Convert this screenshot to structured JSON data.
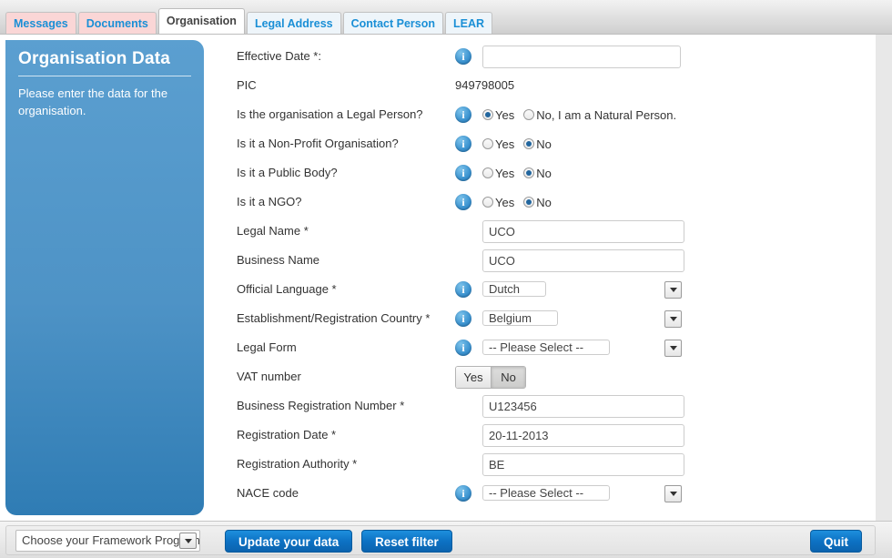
{
  "tabs": [
    {
      "label": "Messages",
      "state": "alert"
    },
    {
      "label": "Documents",
      "state": "alert"
    },
    {
      "label": "Organisation",
      "state": "active"
    },
    {
      "label": "Legal Address",
      "state": "normal"
    },
    {
      "label": "Contact Person",
      "state": "normal"
    },
    {
      "label": "LEAR",
      "state": "normal"
    }
  ],
  "sidebar": {
    "title": "Organisation Data",
    "description": "Please enter the data for the organisation."
  },
  "icons": {
    "info": "i"
  },
  "form": {
    "effective_date": {
      "label": "Effective Date *:",
      "value": "",
      "placeholder": ""
    },
    "pic": {
      "label": "PIC",
      "value": "949798005"
    },
    "legal_person": {
      "label": "Is the organisation a Legal Person?",
      "options": [
        "Yes",
        "No, I am a Natural Person."
      ],
      "selected": "Yes"
    },
    "non_profit": {
      "label": "Is it a Non-Profit Organisation?",
      "options": [
        "Yes",
        "No"
      ],
      "selected": "No"
    },
    "public_body": {
      "label": "Is it a Public Body?",
      "options": [
        "Yes",
        "No"
      ],
      "selected": "No"
    },
    "ngo": {
      "label": "Is it a NGO?",
      "options": [
        "Yes",
        "No"
      ],
      "selected": "No"
    },
    "legal_name": {
      "label": "Legal Name *",
      "value": "UCO"
    },
    "business_name": {
      "label": "Business Name",
      "value": "UCO"
    },
    "official_language": {
      "label": "Official Language *",
      "value": "Dutch"
    },
    "country": {
      "label": "Establishment/Registration Country *",
      "value": "Belgium"
    },
    "legal_form": {
      "label": "Legal Form",
      "value": "-- Please Select --"
    },
    "vat_number": {
      "label": "VAT number",
      "options": [
        "Yes",
        "No"
      ],
      "selected": "No"
    },
    "business_reg_number": {
      "label": "Business Registration Number *",
      "value": "U123456"
    },
    "registration_date": {
      "label": "Registration Date *",
      "value": "20-11-2013"
    },
    "registration_authority": {
      "label": "Registration Authority *",
      "value": "BE"
    },
    "nace_code": {
      "label": "NACE code",
      "value": "-- Please Select --"
    }
  },
  "footer": {
    "framework_programme": "Choose your Framework Programme",
    "update_label": "Update your data",
    "reset_label": "Reset filter",
    "quit_label": "Quit"
  }
}
